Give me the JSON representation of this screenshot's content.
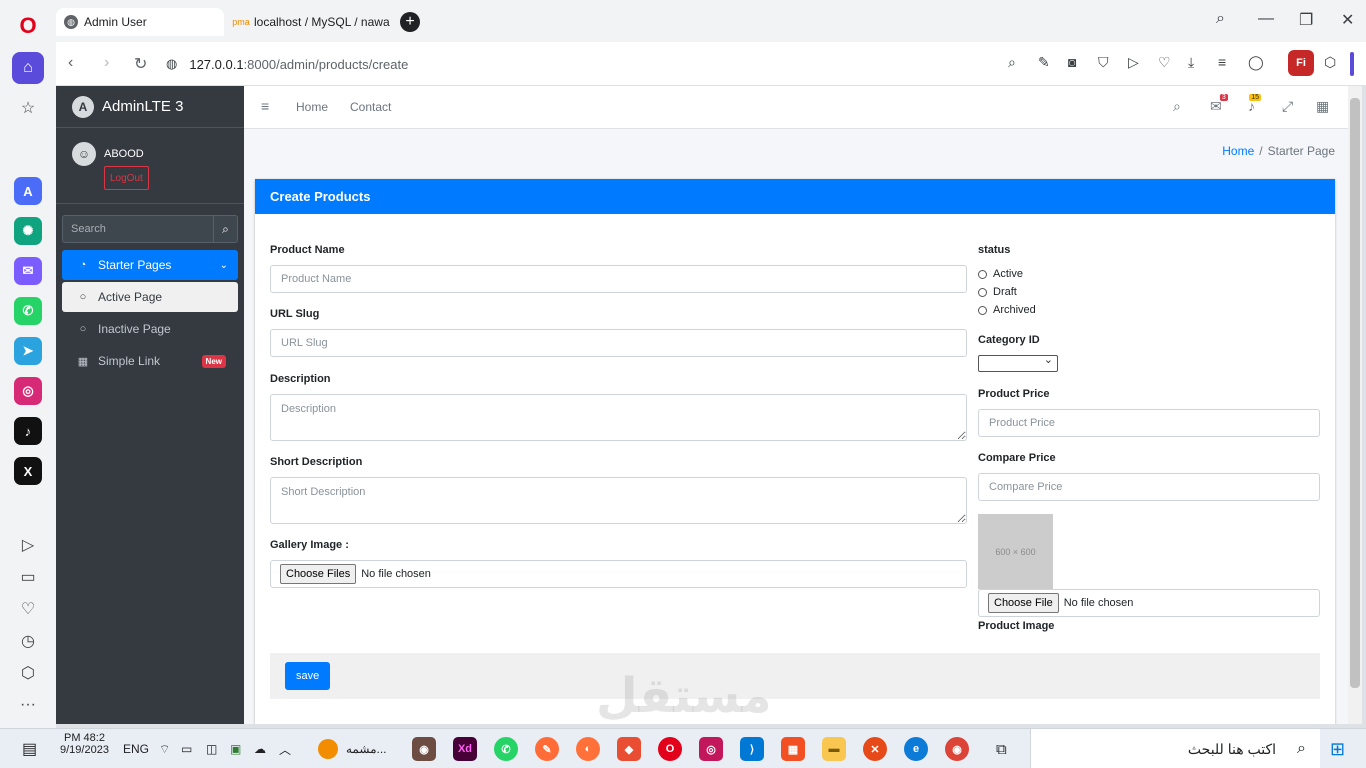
{
  "browser": {
    "tabs": [
      {
        "title": "Admin User"
      },
      {
        "title": "localhost / MySQL / nawa"
      }
    ],
    "new_tab": "+",
    "url_host": "127.0.0.1",
    "url_rest": ":8000/admin/products/create"
  },
  "sidebar": {
    "brand": "AdminLTE 3",
    "brand_logo_letter": "A",
    "user_name": "ABOOD",
    "logout_label": "LogOut",
    "search_placeholder": "Search",
    "menu": [
      {
        "label": "Starter Pages",
        "icon": "dashboard-icon",
        "style": "primary"
      },
      {
        "label": "Active Page",
        "icon": "circle-icon",
        "style": "light"
      },
      {
        "label": "Inactive Page",
        "icon": "circle-icon",
        "style": "none"
      },
      {
        "label": "Simple Link",
        "icon": "grid-icon",
        "style": "none",
        "badge": "New"
      }
    ]
  },
  "navbar": {
    "links": [
      "Home",
      "Contact"
    ],
    "messages_count": "3",
    "notifications_count": "15"
  },
  "breadcrumb": {
    "home": "Home",
    "sep": "/",
    "current": "Starter Page"
  },
  "card": {
    "title": "Create Products",
    "fields": {
      "product_name": {
        "label": "Product Name",
        "placeholder": "Product Name"
      },
      "url_slug": {
        "label": "URL Slug",
        "placeholder": "URL Slug"
      },
      "description": {
        "label": "Description",
        "placeholder": "Description"
      },
      "short_description": {
        "label": "Short Description",
        "placeholder": "Short Description"
      },
      "gallery": {
        "label": "Gallery Image :",
        "button": "Choose Files",
        "status": "No file chosen"
      },
      "status": {
        "label": "status",
        "options": [
          "Active",
          "Draft",
          "Archived"
        ]
      },
      "category": {
        "label": "Category ID"
      },
      "price": {
        "label": "Product Price",
        "placeholder": "Product Price"
      },
      "compare_price": {
        "label": "Compare Price",
        "placeholder": "Compare Price"
      },
      "image": {
        "placeholder_text": "600 × 600",
        "button": "Choose File",
        "status": "No file chosen",
        "label": "Product Image"
      }
    },
    "save_label": "save"
  },
  "taskbar": {
    "time": "PM 48:2",
    "date": "9/19/2023",
    "lang": "ENG",
    "running_app": "مشمه...",
    "search_text": "اكتب هنا للبحث"
  },
  "watermark": "مستقل",
  "colors": {
    "primary": "#007bff",
    "sidebar": "#343a40",
    "danger": "#dc3545"
  }
}
